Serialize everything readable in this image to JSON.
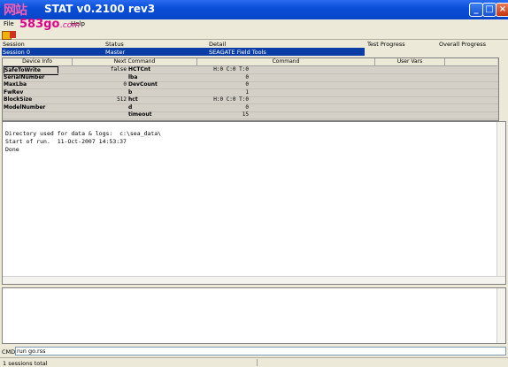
{
  "window": {
    "title": "v0.2100 rev3",
    "title_prefix": "STAT"
  },
  "watermark": {
    "line1": "网站",
    "line2": "583go",
    "line3": ".com"
  },
  "menu": {
    "items": [
      "File",
      "Help"
    ]
  },
  "sessions": {
    "headers": [
      "Session",
      "Status",
      "Detail",
      "Test Progress",
      "Overall Progress"
    ],
    "rows": [
      {
        "session": "Session 0",
        "status": "Master",
        "detail": "SEAGATE Field Tools"
      }
    ]
  },
  "device_grid": {
    "headers": [
      "Device Info",
      "Next Command",
      "Command",
      "User Vars"
    ],
    "rows": [
      {
        "name": "SafeToWrite",
        "value": "false",
        "param": "HCTCnt",
        "param_value": "H:0 C:0 T:0"
      },
      {
        "name": "SerialNumber",
        "value": "",
        "param": "lba",
        "param_value": "0"
      },
      {
        "name": "MaxLba",
        "value": "0",
        "param": "DevCount",
        "param_value": "0"
      },
      {
        "name": "FwRev",
        "value": "",
        "param": "b",
        "param_value": "1"
      },
      {
        "name": "BlockSize",
        "value": "512",
        "param": "hct",
        "param_value": "H:0 C:0 T:0"
      },
      {
        "name": "ModelNumber",
        "value": "",
        "param": "d",
        "param_value": "0"
      },
      {
        "name": "",
        "value": "",
        "param": "timeout",
        "param_value": "15"
      }
    ]
  },
  "log": {
    "lines": [
      "Directory used for data & logs:  c:\\sea_data\\",
      "Start of run.  11-Oct-2007 14:53:37",
      "Done"
    ]
  },
  "cmd": {
    "label": "CMD:",
    "value": "run go.rss"
  },
  "status": {
    "text": "1 sessions total"
  },
  "colors": {
    "titlebar": "#0a4fd8",
    "selected_row": "#0a3ea6",
    "watermark": "#e2008a"
  }
}
